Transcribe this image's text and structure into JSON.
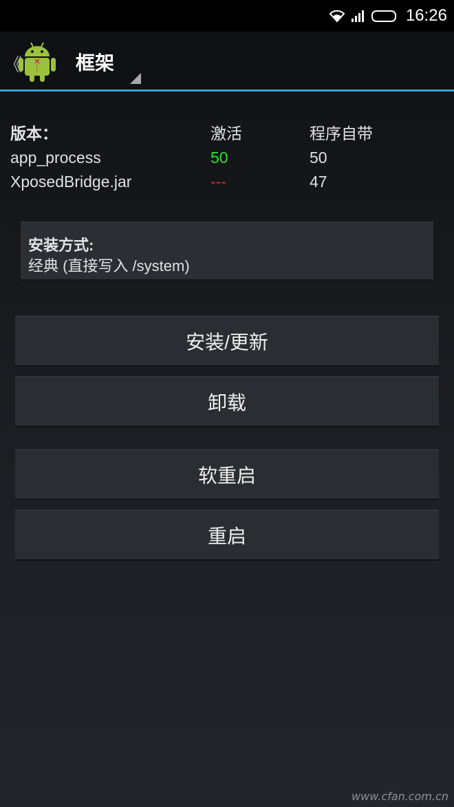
{
  "status_bar": {
    "time": "16:26",
    "icons": [
      "wifi-icon",
      "signal-icon",
      "battery-icon"
    ]
  },
  "action_bar": {
    "title": "框架",
    "up_glyph": "《",
    "accent_color": "#33a3d6"
  },
  "versions": {
    "header": {
      "label": "版本：",
      "active": "激活",
      "bundled": "程序自带"
    },
    "rows": [
      {
        "name": "app_process",
        "active": "50",
        "bundled": "50",
        "active_color": "#2fe02f"
      },
      {
        "name": "XposedBridge.jar",
        "active": "---",
        "bundled": "47",
        "active_color": "#e02b2b"
      }
    ]
  },
  "install_method": {
    "label": "安装方式:",
    "value": "经典 (直接写入 /system)"
  },
  "buttons": {
    "install_update": "安装/更新",
    "uninstall": "卸载",
    "soft_reboot": "软重启",
    "reboot": "重启"
  },
  "watermark": "www.cfan.com.cn"
}
